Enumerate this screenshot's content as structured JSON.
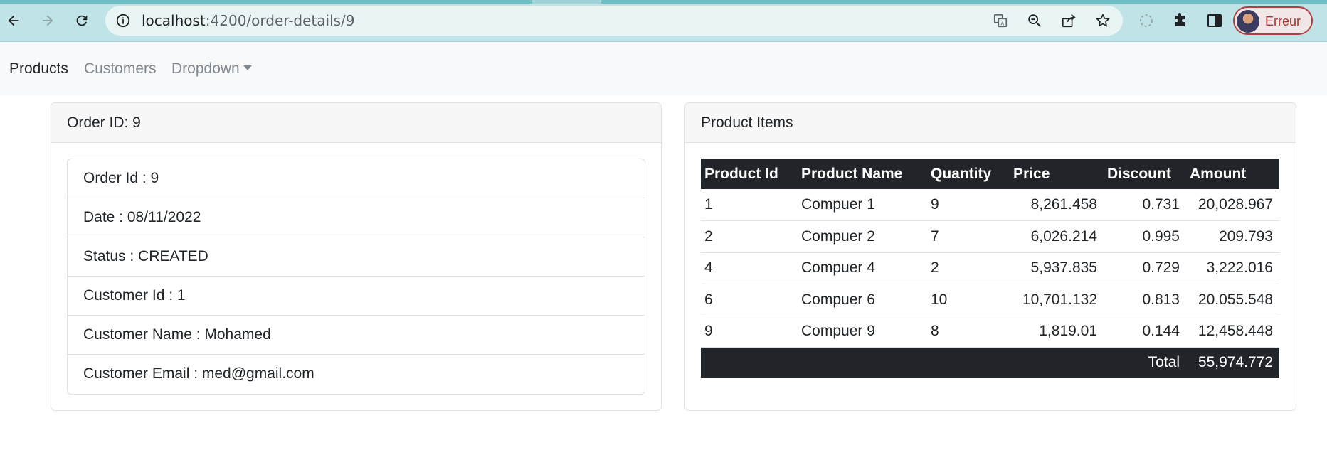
{
  "browser": {
    "url_host": "localhost",
    "url_path": ":4200/order-details/9",
    "profile_label": "Erreur"
  },
  "navbar": {
    "items": [
      {
        "label": "Products"
      },
      {
        "label": "Customers"
      },
      {
        "label": "Dropdown"
      }
    ]
  },
  "order_card": {
    "header": "Order ID: 9",
    "fields": [
      "Order Id : 9",
      "Date : 08/11/2022",
      "Status : CREATED",
      "Customer Id : 1",
      "Customer Name : Mohamed",
      "Customer Email : med@gmail.com"
    ]
  },
  "items_card": {
    "header": "Product Items",
    "columns": [
      "Product Id",
      "Product Name",
      "Quantity",
      "Price",
      "Discount",
      "Amount"
    ],
    "rows": [
      [
        "1",
        "Compuer 1",
        "9",
        "8,261.458",
        "0.731",
        "20,028.967"
      ],
      [
        "2",
        "Compuer 2",
        "7",
        "6,026.214",
        "0.995",
        "209.793"
      ],
      [
        "4",
        "Compuer 4",
        "2",
        "5,937.835",
        "0.729",
        "3,222.016"
      ],
      [
        "6",
        "Compuer 6",
        "10",
        "10,701.132",
        "0.813",
        "20,055.548"
      ],
      [
        "9",
        "Compuer 9",
        "8",
        "1,819.01",
        "0.144",
        "12,458.448"
      ]
    ],
    "total_label": "Total",
    "total_value": "55,974.772"
  }
}
